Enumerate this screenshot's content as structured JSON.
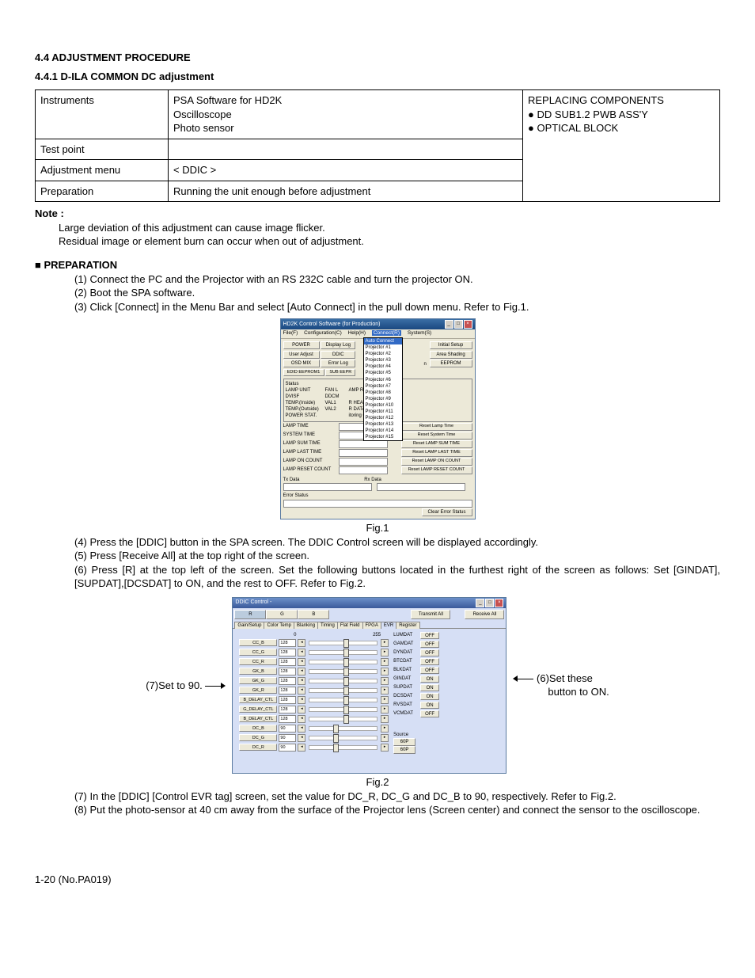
{
  "headings": {
    "h4": "4.4   ADJUSTMENT PROCEDURE",
    "h5": "4.4.1   D-ILA COMMON DC adjustment"
  },
  "table": {
    "r1c1": "Instruments",
    "r1c2": "PSA Software for HD2K\nOscilloscope\nPhoto sensor",
    "r1c3_title": "REPLACING COMPONENTS",
    "r1c3_b1": "DD SUB1.2 PWB ASS'Y",
    "r1c3_b2": "OPTICAL BLOCK",
    "r2c1": "Test point",
    "r2c2": "",
    "r3c1": "Adjustment menu",
    "r3c2": "< DDIC >",
    "r4c1": "Preparation",
    "r4c2": "Running the unit enough before adjustment"
  },
  "note": {
    "label": "Note :",
    "l1": "Large deviation of this adjustment can cause image flicker.",
    "l2": "Residual image or element burn can occur when out of adjustment."
  },
  "prep": {
    "title": "PREPARATION",
    "p1": "(1) Connect the PC and the Projector with an RS 232C cable and turn the projector ON.",
    "p2": "(2) Boot the SPA software.",
    "p3": "(3) Click [Connect] in the Menu Bar and select [Auto Connect] in the pull down menu. Refer to Fig.1."
  },
  "fig1": {
    "caption": "Fig.1",
    "title": "HD2K Control Software (for Production)",
    "menus": [
      "File(F)",
      "Configuration(C)",
      "Help(H)",
      "Connect(R)",
      "System(S)"
    ],
    "btns_left": [
      "POWER",
      "Display Log",
      "User Adjust",
      "DDIC",
      "OSD MIX",
      "Error Log",
      "EDID EEPROM1",
      "SUB EEPR"
    ],
    "btns_right": [
      "Initial Setup",
      "Area Shading",
      "EEPROM"
    ],
    "dropdown_top": "Auto Connect",
    "dropdown_items": [
      "Projector #1",
      "Projector #2",
      "Projector #3",
      "Projector #4",
      "Projector #5",
      "Projector #6",
      "Projector #7",
      "Projector #8",
      "Projector #9",
      "Projector #10",
      "Projector #11",
      "Projector #12",
      "Projector #13",
      "Projector #14",
      "Projector #15"
    ],
    "status_title": "Status",
    "status_left": [
      "LAMP UNIT",
      "DVISF",
      "TEMP.(Inside)",
      "TEMP.(Outside)",
      "POWER STAT."
    ],
    "status_mid": [
      "FAN L",
      "DDCM",
      "VAL1",
      "VAL2"
    ],
    "status_right": [
      "AMP RETURN",
      "R HEADER",
      "R DATA",
      "itoring OFF"
    ],
    "time_labels": [
      "LAMP TIME",
      "SYSTEM TIME",
      "LAMP SUM TIME",
      "LAMP LAST TIME",
      "LAMP ON COUNT",
      "LAMP RESET COUNT"
    ],
    "reset_btns": [
      "Reset Lamp Time",
      "Reset System Time",
      "Reset LAMP SUM TIME",
      "Reset LAMP LAST TIME",
      "Reset LAMP ON COUNT",
      "Reset LAMP RESET COUNT"
    ],
    "tx": "Tx Data",
    "rx": "Rx Data",
    "err": "Error Status",
    "clear": "Clear Error Status"
  },
  "mid": {
    "p4": "(4) Press the [DDIC] button in the SPA screen. The DDIC Control screen will be displayed accordingly.",
    "p5": "(5) Press [Receive All] at the top right of the screen.",
    "p6": "(6) Press [R] at the top left of the screen. Set the following buttons located in the furthest right of the screen as follows: Set [GINDAT],[SUPDAT],[DCSDAT] to ON, and the rest to OFF. Refer to Fig.2."
  },
  "fig2": {
    "caption": "Fig.2",
    "title": "DDIC Control -",
    "top_btns": [
      "R",
      "G",
      "B",
      "Transmit All",
      "Receive All"
    ],
    "tabs": [
      "Gain/Setup",
      "Color Temp",
      "Blanking",
      "Timing",
      "Flat Field",
      "FPGA",
      "EVR",
      "Register"
    ],
    "scale_min": "0",
    "scale_max": "255",
    "sliders": [
      {
        "name": "CC_B",
        "val": "128",
        "pos": 50
      },
      {
        "name": "CC_G",
        "val": "128",
        "pos": 50
      },
      {
        "name": "CC_R",
        "val": "128",
        "pos": 50
      },
      {
        "name": "GK_B",
        "val": "128",
        "pos": 50
      },
      {
        "name": "GK_G",
        "val": "128",
        "pos": 50
      },
      {
        "name": "GK_R",
        "val": "128",
        "pos": 50
      },
      {
        "name": "B_DELAY_CTL",
        "val": "128",
        "pos": 50
      },
      {
        "name": "G_DELAY_CTL",
        "val": "128",
        "pos": 50
      },
      {
        "name": "B_DELAY_CTL",
        "val": "128",
        "pos": 50
      },
      {
        "name": "DC_B",
        "val": "90",
        "pos": 35
      },
      {
        "name": "DC_G",
        "val": "90",
        "pos": 35
      },
      {
        "name": "DC_R",
        "val": "90",
        "pos": 35
      }
    ],
    "toggles": [
      {
        "name": "LUMDAT",
        "state": "OFF"
      },
      {
        "name": "GAMDAT",
        "state": "OFF"
      },
      {
        "name": "DYNDAT",
        "state": "OFF"
      },
      {
        "name": "BTCDAT",
        "state": "OFF"
      },
      {
        "name": "BLKDAT",
        "state": "OFF"
      },
      {
        "name": "GINDAT",
        "state": "ON"
      },
      {
        "name": "SUPDAT",
        "state": "ON"
      },
      {
        "name": "DCSDAT",
        "state": "ON"
      },
      {
        "name": "RVSDAT",
        "state": "ON"
      },
      {
        "name": "VCMDAT",
        "state": "OFF"
      }
    ],
    "source_label": "Source",
    "source_btns": [
      "60P",
      "60P"
    ],
    "annot_left": "(7)Set to 90.",
    "annot_right_1": "(6)Set these",
    "annot_right_2": "button to ON."
  },
  "tail": {
    "p7": "(7) In the [DDIC] [Control EVR tag] screen, set the value for DC_R, DC_G and DC_B to 90,  respectively. Refer to Fig.2.",
    "p8": "(8) Put the photo-sensor at 40 cm away from the surface of the Projector lens (Screen center) and connect the sensor to the oscilloscope."
  },
  "footer": "1-20  (No.PA019)"
}
